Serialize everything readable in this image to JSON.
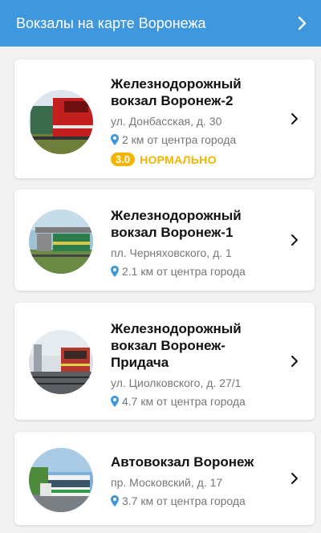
{
  "header": {
    "title": "Вокзалы на карте Воронежа",
    "chevron_icon": "chevron-right-icon"
  },
  "colors": {
    "header_bg": "#3f97dd",
    "rating": "#f2b600",
    "pin": "#3f97dd"
  },
  "stations": [
    {
      "title_line1": "Железнодорожный",
      "title_line2": "вокзал Воронеж-2",
      "address": "ул. Донбасская, д. 30",
      "distance": "2 км от центра города",
      "rating_value": "3.0",
      "rating_label": "НОРМАЛЬНО"
    },
    {
      "title_line1": "Железнодорожный",
      "title_line2": "вокзал Воронеж-1",
      "address": "пл. Черняховского, д. 1",
      "distance": "2.1 км от центра города"
    },
    {
      "title_line1": "Железнодорожный",
      "title_line2": "вокзал Воронеж-",
      "title_line3": "Придача",
      "address": "ул. Циолковского, д. 27/1",
      "distance": "4.7 км от центра города"
    },
    {
      "title_line1": "Автовокзал Воронеж",
      "address": "пр. Московский, д. 17",
      "distance": "3.7 км от центра города"
    }
  ]
}
